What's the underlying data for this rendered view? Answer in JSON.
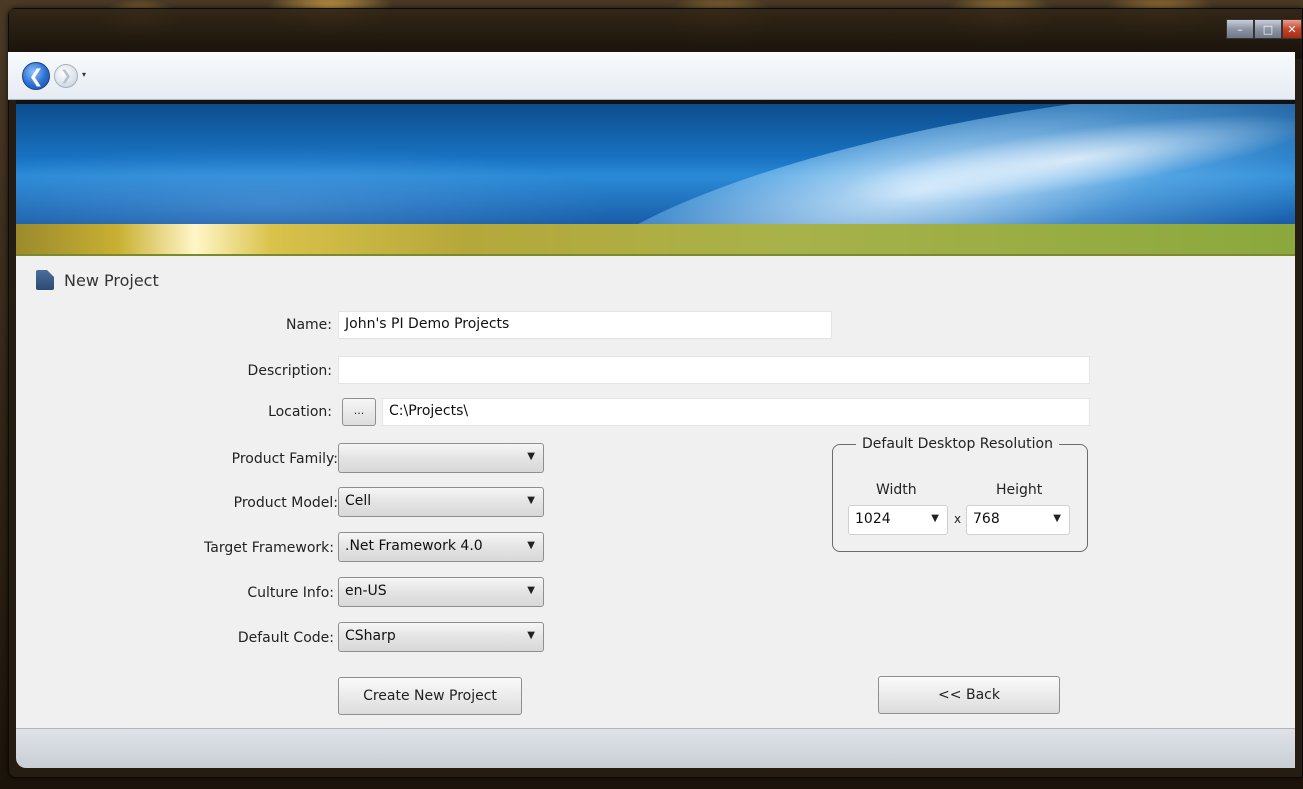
{
  "window": {
    "caption_minimize": "–",
    "caption_maximize": "□",
    "caption_close": "✕"
  },
  "nav": {
    "back_glyph": "❮",
    "forward_glyph": "❯",
    "history_dropdown": "▾"
  },
  "page": {
    "title": "New Project"
  },
  "form": {
    "name_label": "Name:",
    "name_value": "John's PI Demo Projects",
    "description_label": "Description:",
    "description_value": "",
    "location_label": "Location:",
    "location_browse": "...",
    "location_value": "C:\\Projects\\",
    "product_family_label": "Product Family:",
    "product_family_value": "",
    "product_model_label": "Product Model:",
    "product_model_value": "Cell",
    "target_framework_label": "Target Framework:",
    "target_framework_value": ".Net Framework 4.0",
    "culture_info_label": "Culture Info:",
    "culture_info_value": "en-US",
    "default_code_label": "Default Code:",
    "default_code_value": "CSharp"
  },
  "resolution": {
    "group_title": "Default Desktop Resolution",
    "width_label": "Width",
    "height_label": "Height",
    "width_value": "1024",
    "separator": "x",
    "height_value": "768"
  },
  "buttons": {
    "create": "Create New Project",
    "back": "<< Back"
  },
  "icons": {
    "dropdown_arrow": "▼"
  }
}
